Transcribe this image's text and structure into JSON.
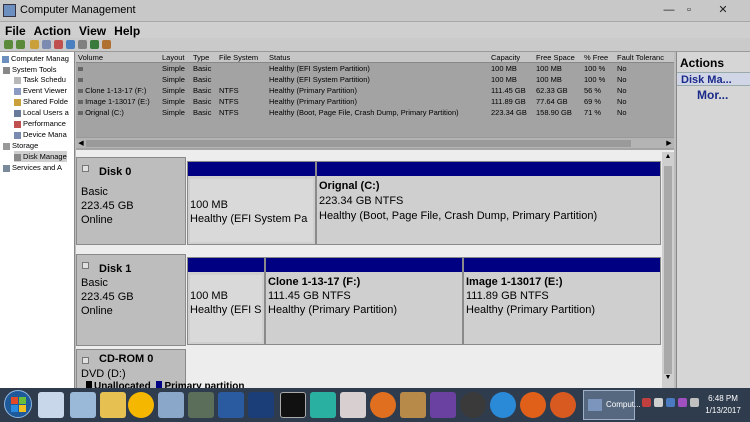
{
  "window": {
    "title": "Computer Management",
    "controls": {
      "minimize": "—",
      "maximize": "▫",
      "close": "✕"
    }
  },
  "menu": [
    "File",
    "Action",
    "View",
    "Help"
  ],
  "tree": [
    {
      "label": "Computer Manag",
      "level": 0
    },
    {
      "label": "System Tools",
      "level": 1
    },
    {
      "label": "Task Schedu",
      "level": 2
    },
    {
      "label": "Event Viewer",
      "level": 2
    },
    {
      "label": "Shared Folde",
      "level": 2
    },
    {
      "label": "Local Users a",
      "level": 2
    },
    {
      "label": "Performance",
      "level": 2
    },
    {
      "label": "Device Mana",
      "level": 2
    },
    {
      "label": "Storage",
      "level": 1
    },
    {
      "label": "Disk Manage",
      "level": 2,
      "selected": true
    },
    {
      "label": "Services and A",
      "level": 1
    }
  ],
  "volume_table": {
    "headers": [
      "Volume",
      "Layout",
      "Type",
      "File System",
      "Status",
      "Capacity",
      "Free Space",
      "% Free",
      "Fault Toleranc"
    ],
    "rows": [
      [
        "",
        "Simple",
        "Basic",
        "",
        "Healthy (EFI System Partition)",
        "100 MB",
        "100 MB",
        "100 %",
        "No"
      ],
      [
        "",
        "Simple",
        "Basic",
        "",
        "Healthy (EFI System Partition)",
        "100 MB",
        "100 MB",
        "100 %",
        "No"
      ],
      [
        "Clone 1-13-17 (F:)",
        "Simple",
        "Basic",
        "NTFS",
        "Healthy (Primary Partition)",
        "111.45 GB",
        "62.33 GB",
        "56 %",
        "No"
      ],
      [
        "Image 1-13017 (E:)",
        "Simple",
        "Basic",
        "NTFS",
        "Healthy (Primary Partition)",
        "111.89 GB",
        "77.64 GB",
        "69 %",
        "No"
      ],
      [
        "Orignal (C:)",
        "Simple",
        "Basic",
        "NTFS",
        "Healthy (Boot, Page File, Crash Dump, Primary Partition)",
        "223.34 GB",
        "158.90 GB",
        "71 %",
        "No"
      ]
    ]
  },
  "disks": {
    "disk0": {
      "name": "Disk 0",
      "type": "Basic",
      "size": "223.45 GB",
      "status": "Online",
      "p1": {
        "l1": "100 MB",
        "l2": "Healthy (EFI System Pa"
      },
      "p2": {
        "title": "Orignal  (C:)",
        "l1": "223.34 GB NTFS",
        "l2": "Healthy (Boot, Page File, Crash Dump, Primary Partition)"
      }
    },
    "disk1": {
      "name": "Disk 1",
      "type": "Basic",
      "size": "223.45 GB",
      "status": "Online",
      "p1": {
        "l1": "100 MB",
        "l2": "Healthy (EFI S"
      },
      "p2": {
        "title": "Clone 1-13-17  (F:)",
        "l1": "111.45 GB NTFS",
        "l2": "Healthy (Primary Partition)"
      },
      "p3": {
        "title": "Image 1-13017  (E:)",
        "l1": "111.89 GB NTFS",
        "l2": "Healthy (Primary Partition)"
      }
    },
    "cdrom": {
      "name": "CD-ROM 0",
      "l1": "DVD (D:)"
    }
  },
  "legend": {
    "unallocated": "Unallocated",
    "primary": "Primary partition"
  },
  "actions": {
    "header": "Actions",
    "section": "Disk Ma...",
    "more": "Mor..."
  },
  "taskbar": {
    "active_task": "Comput...",
    "time": "6:48 PM",
    "date": "1/13/2017"
  },
  "colors": {
    "partition_bar": "#000082",
    "taskbar": "#2f3c4e"
  }
}
